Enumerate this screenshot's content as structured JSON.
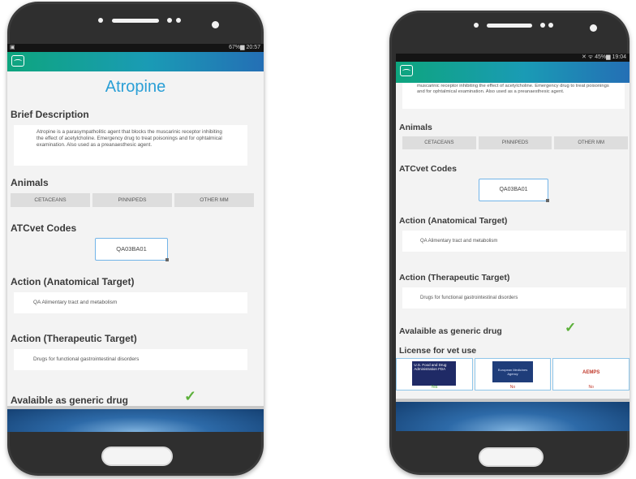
{
  "left_phone": {
    "status_bar": {
      "right": "67%▆ 20:57",
      "left": "▣"
    },
    "drug_name": "Atropine",
    "brief_description": {
      "title": "Brief Description",
      "text": "Atropine is a parasympatholitic agent that blocks the muscarinic receptor inhibiting the effect of acetylcholine. Emergency drug to treat poisonings and for ophtalmical examination. Also used as a preanaesthesic agent."
    },
    "animals": {
      "title": "Animals",
      "tabs": [
        "CETACEANS",
        "PINNIPEDS",
        "OTHER MM"
      ]
    },
    "atcvet": {
      "title": "ATCvet Codes",
      "code": "QA03BA01"
    },
    "action_anatomical": {
      "title": "Action (Anatomical Target)",
      "text": "QA Alimentary tract and metabolism"
    },
    "action_therapeutic": {
      "title": "Action (Therapeutic Target)",
      "text": "Drugs for functional gastrointestinal disorders"
    },
    "generic": {
      "title": "Avalaible as generic drug",
      "check": "✓"
    }
  },
  "right_phone": {
    "status_bar": {
      "right": "✕ ᯤ 45%▆ 19:04"
    },
    "description_tail": "muscarinic receptor inhibiting the effect of acetylcholine. Emergency drug to treat poisonings and for ophtalmical examination. Also used as a preanaesthesic agent.",
    "animals": {
      "title": "Animals",
      "tabs": [
        "CETACEANS",
        "PINNIPEDS",
        "OTHER MM"
      ]
    },
    "atcvet": {
      "title": "ATCvet Codes",
      "code": "QA03BA01"
    },
    "action_anatomical": {
      "title": "Action (Anatomical Target)",
      "text": "QA Alimentary tract and metabolism"
    },
    "action_therapeutic": {
      "title": "Action (Therapeutic Target)",
      "text": "Drugs for functional gastrointestinal disorders"
    },
    "generic": {
      "title": "Avalaible as generic drug",
      "check": "✓"
    },
    "license": {
      "title": "License for vet use",
      "agencies": [
        {
          "logo_text": "U.S. Food and Drug Administration FDA",
          "status": "Yes",
          "status_color": "#3c9a2a"
        },
        {
          "logo_text": "European Medicines Agency",
          "status": "No",
          "status_color": "#c0392b"
        },
        {
          "logo_text": "AEMPS",
          "status": "No",
          "status_color": "#c0392b"
        }
      ]
    }
  },
  "colors": {
    "accent_blue": "#2a9fd6",
    "check_green": "#5cb03a",
    "appbar_start": "#0ea57e",
    "appbar_end": "#246fb5"
  }
}
